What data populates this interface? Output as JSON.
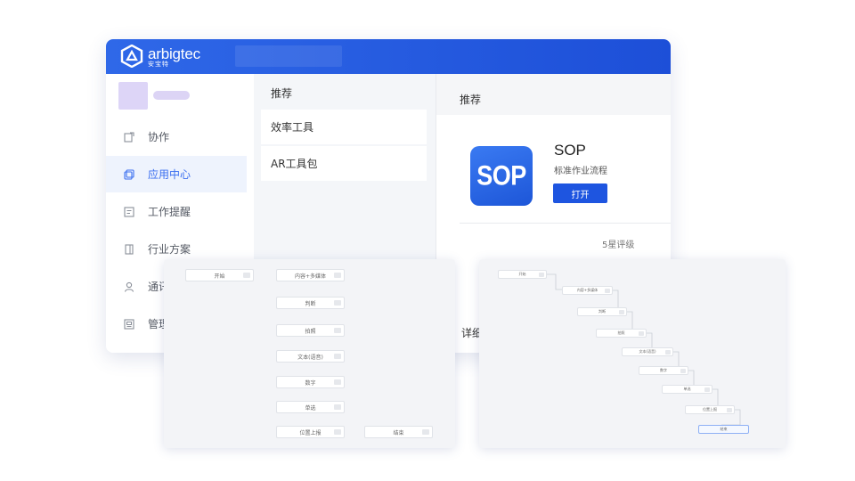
{
  "brand": {
    "name": "arbigtec",
    "subname": "安宝特"
  },
  "colors": {
    "titlebar": "#1d4fd8",
    "accent": "#3a6ef0",
    "button": "#1e55e0"
  },
  "sidebar": {
    "items": [
      {
        "label": "协作",
        "icon": "collaborate-icon",
        "active": false
      },
      {
        "label": "应用中心",
        "icon": "app-center-icon",
        "active": true
      },
      {
        "label": "工作提醒",
        "icon": "reminder-icon",
        "active": false
      },
      {
        "label": "行业方案",
        "icon": "book-icon",
        "active": false
      },
      {
        "label": "通讯",
        "icon": "contacts-icon",
        "active": false
      },
      {
        "label": "管理",
        "icon": "manage-icon",
        "active": false
      }
    ]
  },
  "middle": {
    "header": "推荐",
    "items": [
      {
        "label": "效率工具"
      },
      {
        "label": "AR工具包"
      }
    ]
  },
  "right": {
    "header": "推荐",
    "app": {
      "icon_text": "SOP",
      "name": "SOP",
      "description": "标准作业流程",
      "open_label": "打开"
    },
    "rating_label": "5星评级",
    "detail_label": "详细"
  },
  "flow_left": {
    "nodes": [
      {
        "label": "开始"
      },
      {
        "label": "内容+多媒体"
      },
      {
        "label": "判断"
      },
      {
        "label": "拍照"
      },
      {
        "label": "文本(语音)"
      },
      {
        "label": "数字"
      },
      {
        "label": "单选"
      },
      {
        "label": "位置上报"
      },
      {
        "label": "结束"
      }
    ]
  },
  "flow_right": {
    "nodes": [
      {
        "label": "开始"
      },
      {
        "label": "内容+多媒体"
      },
      {
        "label": "判断"
      },
      {
        "label": "拍照"
      },
      {
        "label": "文本(语音)"
      },
      {
        "label": "数字"
      },
      {
        "label": "单选"
      },
      {
        "label": "位置上报"
      },
      {
        "label": "结束"
      }
    ]
  }
}
